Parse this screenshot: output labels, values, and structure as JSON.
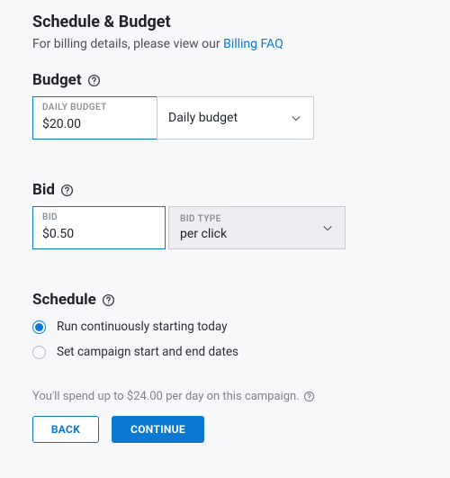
{
  "title": "Schedule & Budget",
  "billing": {
    "prefix": "For billing details, please view our ",
    "link_label": "Billing FAQ"
  },
  "budget": {
    "heading": "Budget",
    "field_label": "DAILY BUDGET",
    "value": "$20.00",
    "type_selected": "Daily budget"
  },
  "bid": {
    "heading": "Bid",
    "field_label": "BID",
    "value": "$0.50",
    "type_label": "BID TYPE",
    "type_selected": "per click"
  },
  "schedule": {
    "heading": "Schedule",
    "options": [
      "Run continuously starting today",
      "Set campaign start and end dates"
    ]
  },
  "spend_note": "You'll spend up to $24.00 per day on this campaign.",
  "buttons": {
    "back": "BACK",
    "continue": "CONTINUE"
  }
}
